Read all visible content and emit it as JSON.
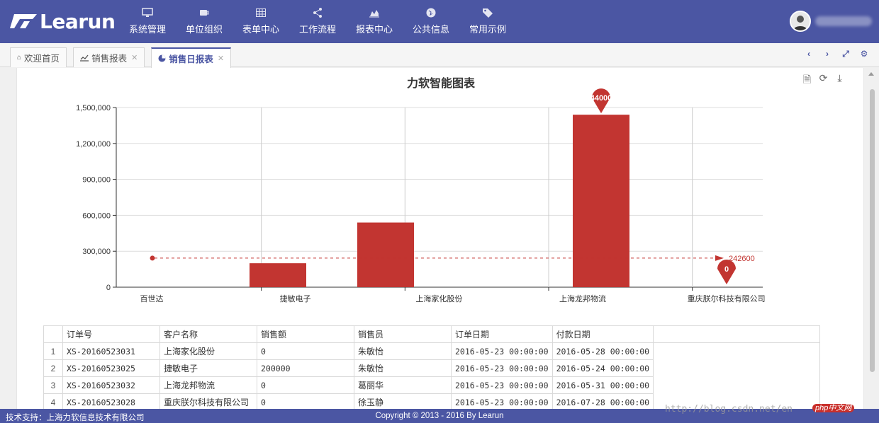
{
  "brand": {
    "name": "Learun"
  },
  "nav": [
    {
      "label": "系统管理",
      "icon": "desktop-icon"
    },
    {
      "label": "单位组织",
      "icon": "coffee-icon"
    },
    {
      "label": "表单中心",
      "icon": "table-icon"
    },
    {
      "label": "工作流程",
      "icon": "share-icon"
    },
    {
      "label": "报表中心",
      "icon": "area-chart-icon"
    },
    {
      "label": "公共信息",
      "icon": "globe-icon"
    },
    {
      "label": "常用示例",
      "icon": "tags-icon"
    }
  ],
  "tabs": [
    {
      "label": "欢迎首页",
      "icon": "home-icon",
      "closable": false
    },
    {
      "label": "销售报表",
      "icon": "line-chart-icon",
      "closable": true
    },
    {
      "label": "销售日报表",
      "icon": "pie-chart-icon",
      "closable": true,
      "active": true
    }
  ],
  "chart_data": {
    "type": "bar",
    "title": "力软智能图表",
    "categories": [
      "百世达",
      "捷敏电子",
      "上海家化股份",
      "上海龙邦物流",
      "重庆朕尔科技有限公司"
    ],
    "values": [
      0,
      200000,
      540000,
      0,
      1440000,
      0
    ],
    "ylim": [
      0,
      1500000
    ],
    "yticks": [
      "0",
      "300,000",
      "600,000",
      "900,000",
      "1,200,000",
      "1,500,000"
    ],
    "mark_line": {
      "label": "242600",
      "value": 242600
    },
    "mark_points": [
      {
        "label": "44000",
        "type": "max"
      },
      {
        "label": "0",
        "type": "min"
      }
    ],
    "color": "#c23531"
  },
  "toolbox": [
    {
      "name": "data-view-icon"
    },
    {
      "name": "restore-icon"
    },
    {
      "name": "save-image-icon"
    }
  ],
  "table": {
    "headers": [
      "订单号",
      "客户名称",
      "销售额",
      "销售员",
      "订单日期",
      "付款日期"
    ],
    "rows": [
      {
        "n": "1",
        "cells": [
          "XS-20160523031",
          "上海家化股份",
          "0",
          "朱敏怡",
          "2016-05-23 00:00:00",
          "2016-05-28 00:00:00"
        ]
      },
      {
        "n": "2",
        "cells": [
          "XS-20160523025",
          "捷敏电子",
          "200000",
          "朱敏怡",
          "2016-05-23 00:00:00",
          "2016-05-24 00:00:00"
        ]
      },
      {
        "n": "3",
        "cells": [
          "XS-20160523032",
          "上海龙邦物流",
          "0",
          "葛丽华",
          "2016-05-23 00:00:00",
          "2016-05-31 00:00:00"
        ]
      },
      {
        "n": "4",
        "cells": [
          "XS-20160523028",
          "重庆朕尔科技有限公司",
          "0",
          "徐玉静",
          "2016-05-23 00:00:00",
          "2016-07-28 00:00:00"
        ]
      }
    ]
  },
  "footer": {
    "support": "技术支持：上海力软信息技术有限公司",
    "copyright": "Copyright © 2013 - 2016 By Learun"
  },
  "watermark": {
    "text": "http://blog.csdn.net/en",
    "badge": "php中文网"
  },
  "colors": {
    "primary": "#4b56a3",
    "bar": "#c23531"
  }
}
